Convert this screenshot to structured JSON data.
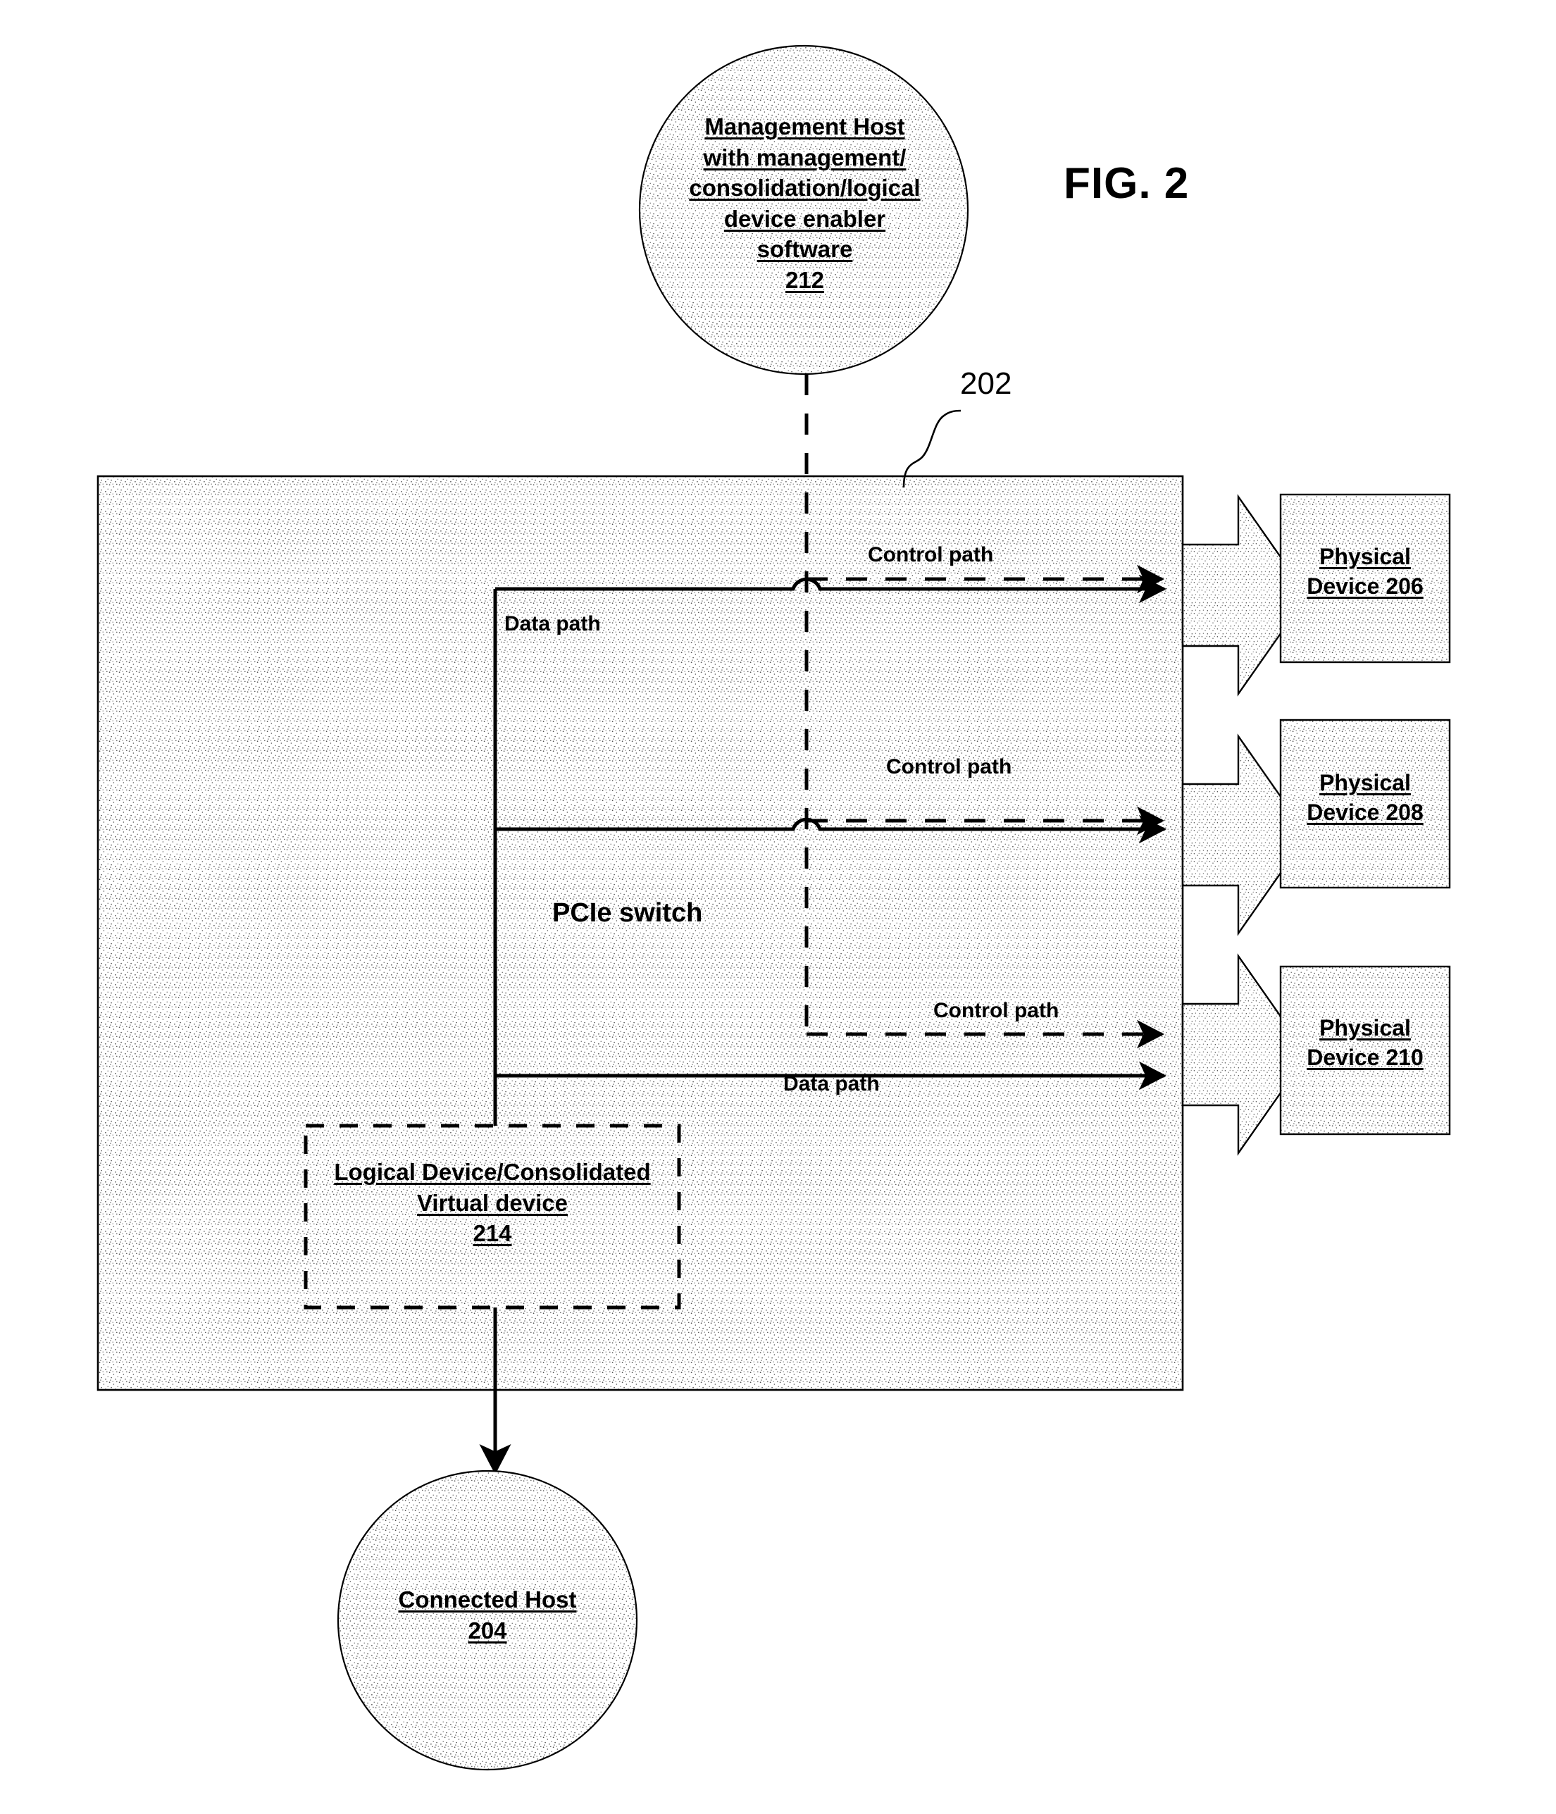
{
  "figure": {
    "label": "FIG. 2",
    "reference_callout": "202"
  },
  "nodes": {
    "management_host": {
      "lines": [
        "Management Host",
        "with management/",
        "consolidation/logical",
        "device enabler",
        "software",
        "212"
      ]
    },
    "switch": {
      "label": "PCIe switch"
    },
    "logical_device": {
      "lines": [
        "Logical Device/Consolidated",
        "Virtual device",
        "214"
      ]
    },
    "connected_host": {
      "lines": [
        "Connected Host",
        "204"
      ]
    },
    "physical_devices": [
      {
        "lines": [
          "Physical",
          "Device 206"
        ]
      },
      {
        "lines": [
          "Physical",
          "Device 208"
        ]
      },
      {
        "lines": [
          "Physical",
          "Device 210"
        ]
      }
    ]
  },
  "edges": {
    "control_paths": [
      {
        "label": "Control path"
      },
      {
        "label": "Control path"
      },
      {
        "label": "Control path"
      }
    ],
    "data_paths": [
      {
        "label": "Data path"
      },
      {
        "label": "Data path"
      }
    ]
  },
  "colors": {
    "stroke": "#000000",
    "fill_white": "#ffffff",
    "hatch_dot": "#3a3a3a"
  }
}
